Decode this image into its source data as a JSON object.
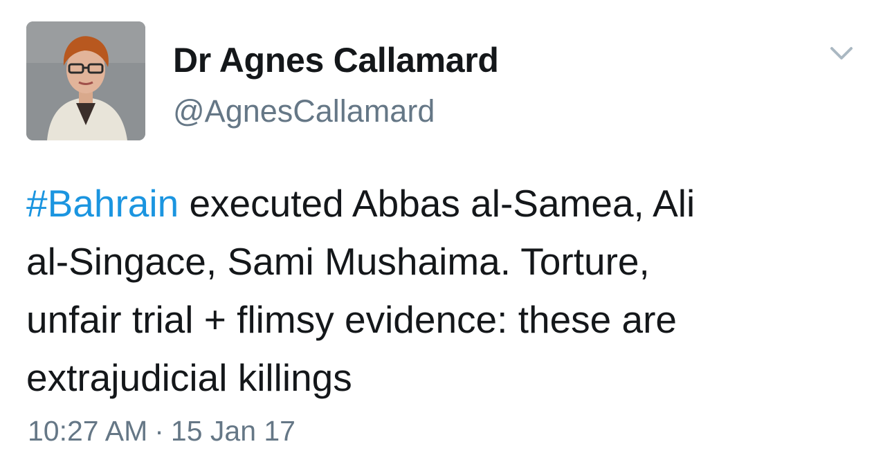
{
  "user": {
    "display_name": "Dr Agnes Callamard",
    "handle": "@AgnesCallamard"
  },
  "menu": {
    "icon": "chevron-down-icon"
  },
  "tweet": {
    "hashtag": "#Bahrain",
    "line1_rest": " executed Abbas al-Samea, Ali",
    "line2": "al-Singace, Sami Mushaima. Torture,",
    "line3": "unfair trial + flimsy evidence: these are",
    "line4": "extrajudicial killings"
  },
  "meta": {
    "time": "10:27 AM",
    "separator": "·",
    "date": "15 Jan 17"
  },
  "colors": {
    "link": "#1b95e0",
    "text": "#14171a",
    "secondary": "#657786"
  }
}
